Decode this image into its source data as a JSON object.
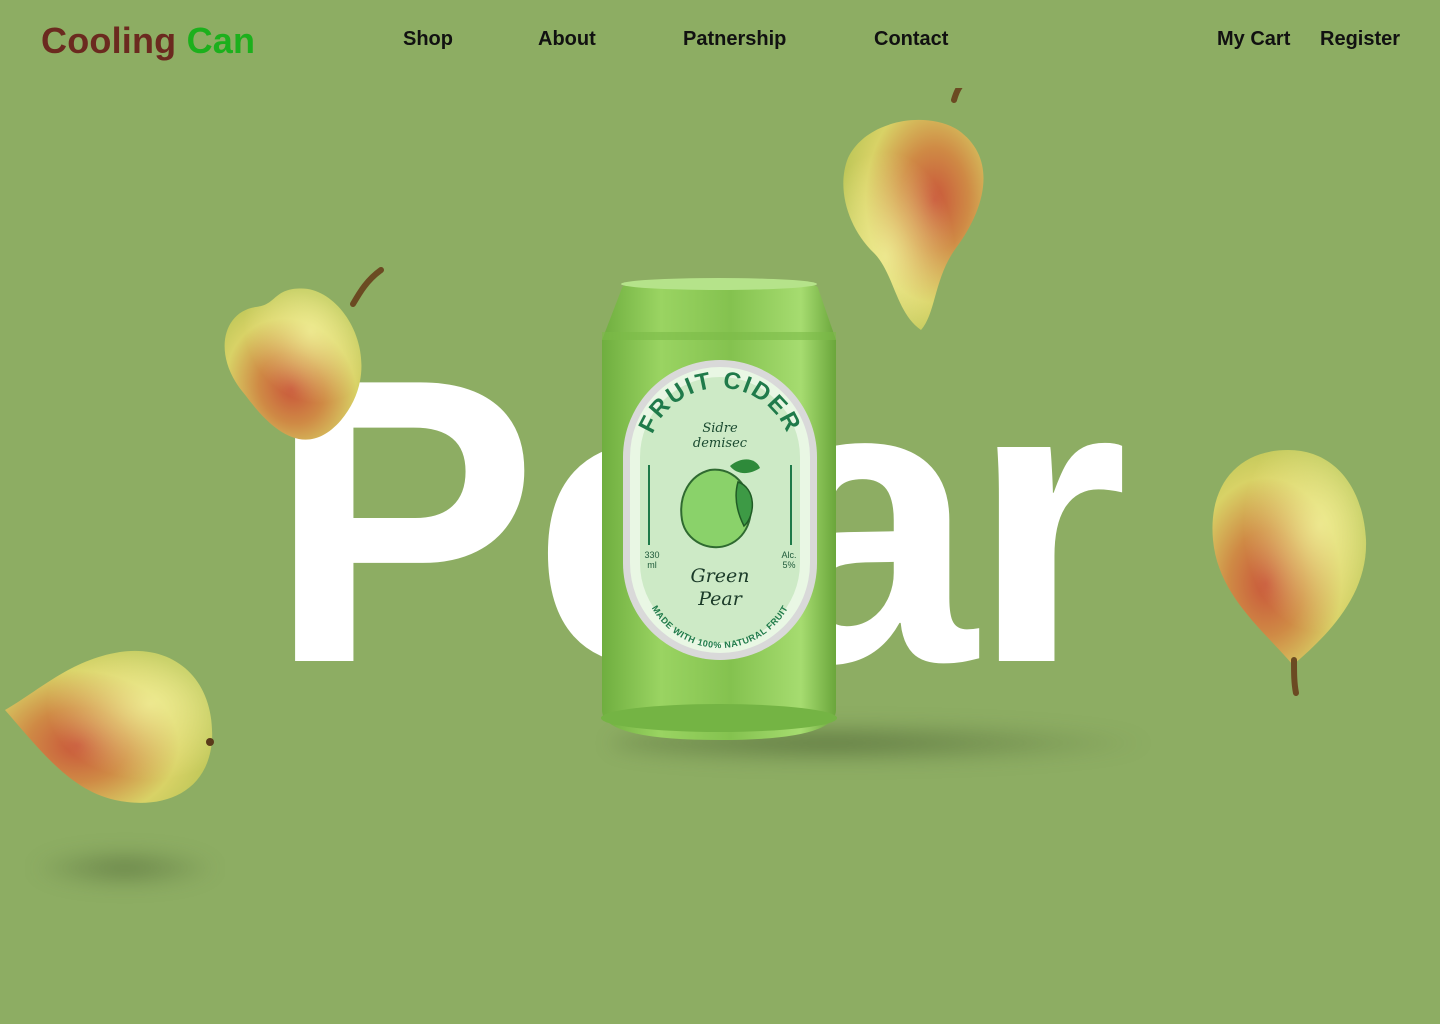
{
  "brand": {
    "part1": "Cooling",
    "part2": "Can"
  },
  "nav": {
    "links": [
      {
        "label": "Shop"
      },
      {
        "label": "About"
      },
      {
        "label": "Patnership"
      },
      {
        "label": "Contact"
      }
    ],
    "cart_label": "My Cart",
    "register_label": "Register"
  },
  "hero": {
    "word": "Pear"
  },
  "can": {
    "title": "FRUIT CIDER",
    "subtitle_line1": "Sidre",
    "subtitle_line2": "demisec",
    "volume_line1": "330",
    "volume_line2": "ml",
    "alcohol_line1": "Alc.",
    "alcohol_line2": "5%",
    "flavor_line1": "Green",
    "flavor_line2": "Pear",
    "bottom_text": "MADE WITH 100% NATURAL FRUIT"
  },
  "colors": {
    "background": "#8dad63",
    "brand_dark": "#6b2a1f",
    "brand_green": "#1cb01c",
    "can_green": "#8fce5a",
    "label_text": "#1f7a4a"
  }
}
